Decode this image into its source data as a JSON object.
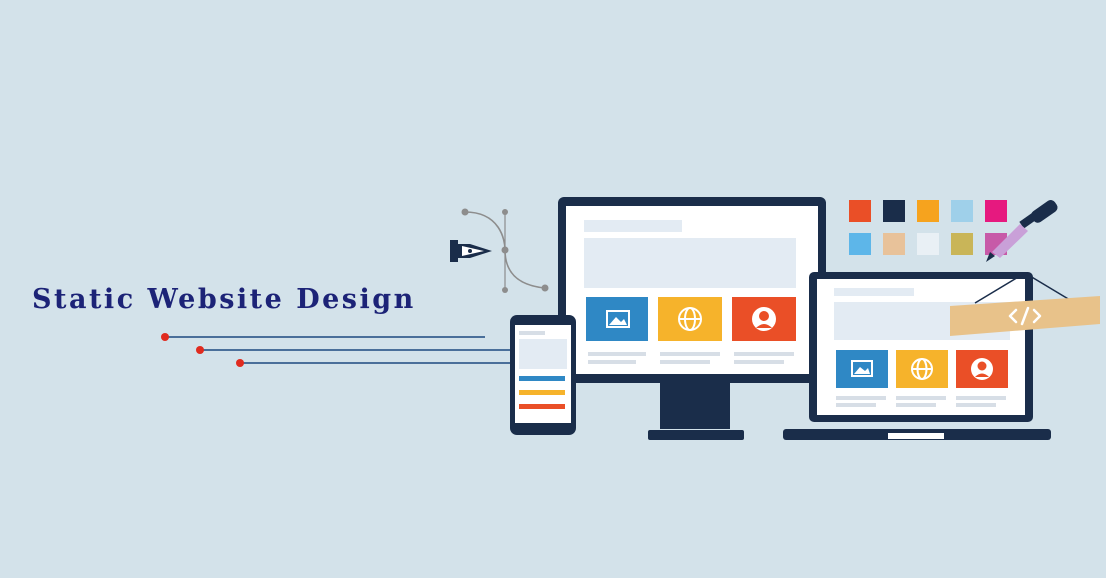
{
  "banner": {
    "title": "Static Website Design"
  },
  "colors": {
    "background": "#d3e2ea",
    "title": "#1c2377",
    "device_frame": "#1a2d4a",
    "accent_blue": "#2f88c5",
    "accent_yellow": "#f6b32b",
    "accent_red": "#ea4f27",
    "accent_dot": "#e02b1f",
    "tag_fill": "#e8c28a"
  },
  "palette_swatches": [
    "#ea4f27",
    "#1a2d4a",
    "#f6a31e",
    "#9fd0ea",
    "#e6197f",
    "#5db6e9",
    "#e8c29a",
    "#e9f0f5",
    "#c9b558",
    "#c75aa8"
  ],
  "icons": {
    "pen_tool": "pen-tool-icon",
    "eyedropper": "eyedropper-icon",
    "image": "image-icon",
    "globe": "globe-icon",
    "user": "user-icon",
    "code": "code-icon"
  }
}
